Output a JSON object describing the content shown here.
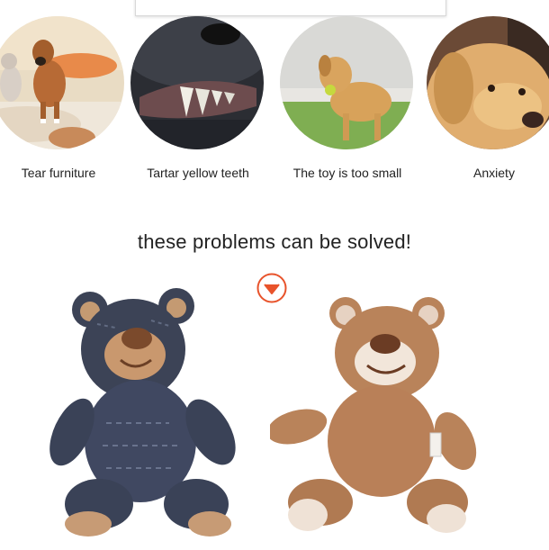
{
  "problems": [
    {
      "caption": "Tear furniture",
      "icon": "dog-on-couch-photo"
    },
    {
      "caption": "Tartar yellow teeth",
      "icon": "dog-teeth-photo"
    },
    {
      "caption": "The toy is too small",
      "icon": "dog-with-ball-photo"
    },
    {
      "caption": "Anxiety",
      "icon": "sad-dog-photo"
    }
  ],
  "headline": "these problems can be solved!",
  "colors": {
    "accent": "#e8532b",
    "denim_bear": "#3c4356",
    "brown_bear": "#b9835a"
  }
}
